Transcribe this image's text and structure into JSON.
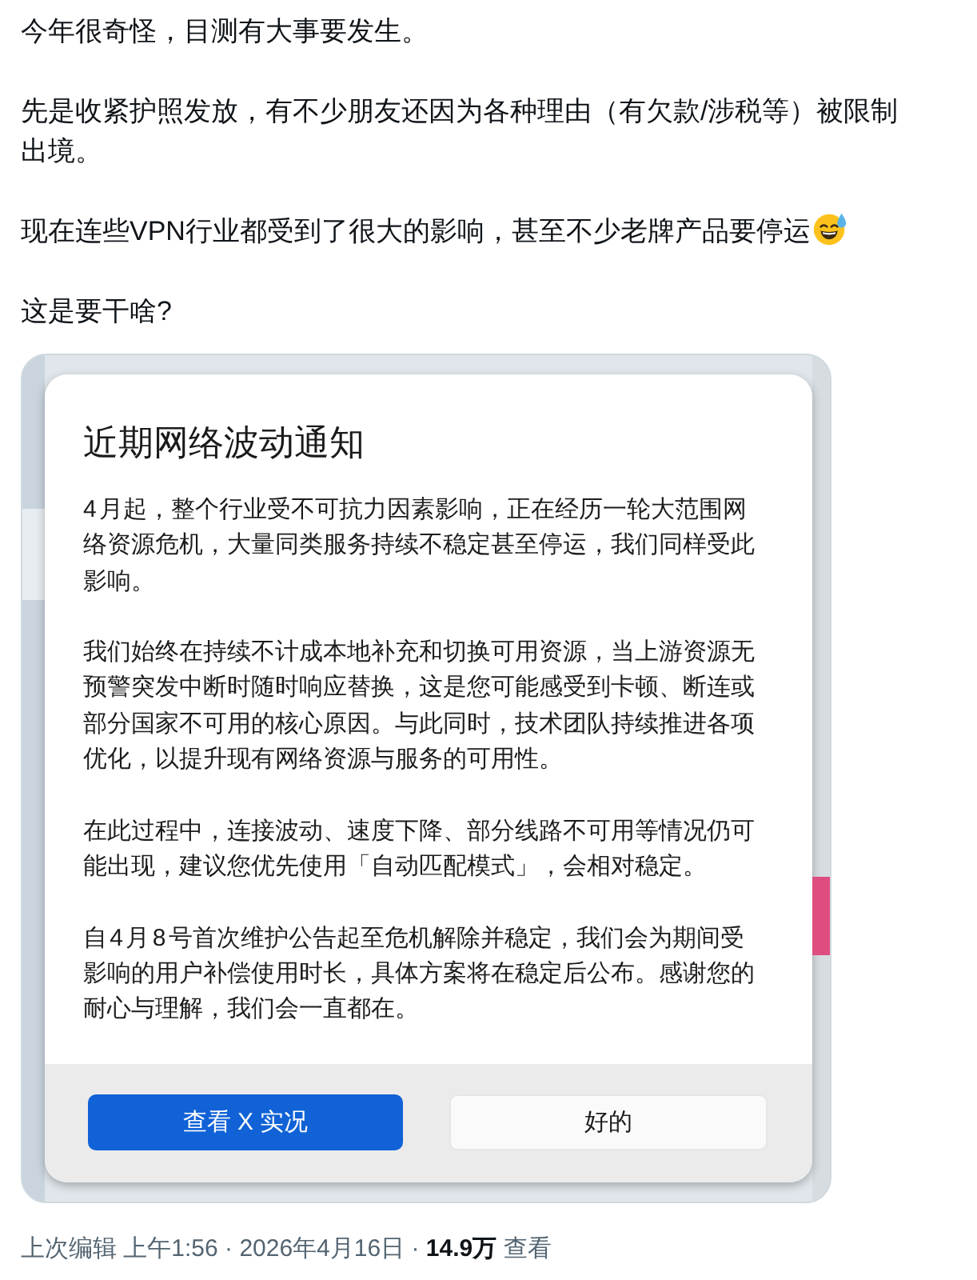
{
  "post": {
    "paragraphs": [
      {
        "text": "今年很奇怪，目测有大事要发生。",
        "trailing_emoji": false
      },
      {
        "text": "先是收紧护照发放，有不少朋友还因为各种理由（有欠款/涉税等）被限制出境。",
        "trailing_emoji": false
      },
      {
        "text": "现在连些VPN行业都受到了很大的影响，甚至不少老牌产品要停运",
        "trailing_emoji": true
      },
      {
        "text": "这是要干啥?",
        "trailing_emoji": false
      }
    ]
  },
  "embedded_screenshot": {
    "dialog": {
      "title": "近期网络波动通知",
      "paragraphs": [
        "4 月起，整个行业受不可抗力因素影响，正在经历一轮大范围网络资源危机，大量同类服务持续不稳定甚至停运，我们同样受此影响。",
        "我们始终在持续不计成本地补充和切换可用资源，当上游资源无预警突发中断时随时响应替换，这是您可能感受到卡顿、断连或部分国家不可用的核心原因。与此同时，技术团队持续推进各项优化，以提升现有网络资源与服务的可用性。",
        "在此过程中，连接波动、速度下降、部分线路不可用等情况仍可能出现，建议您优先使用「自动匹配模式」，会相对稳定。",
        "自 4 月 8 号首次维护公告起至危机解除并稳定，我们会为期间受影响的用户补偿使用时长，具体方案将在稳定后公布。感谢您的耐心与理解，我们会一直都在。"
      ],
      "buttons": [
        {
          "label": "查看 X 实况",
          "kind": "primary"
        },
        {
          "label": "好的",
          "kind": "dismiss"
        }
      ]
    }
  },
  "meta": "上次编辑 上午1:56 · 2026年4月16日 · **14.9万** 查看"
}
